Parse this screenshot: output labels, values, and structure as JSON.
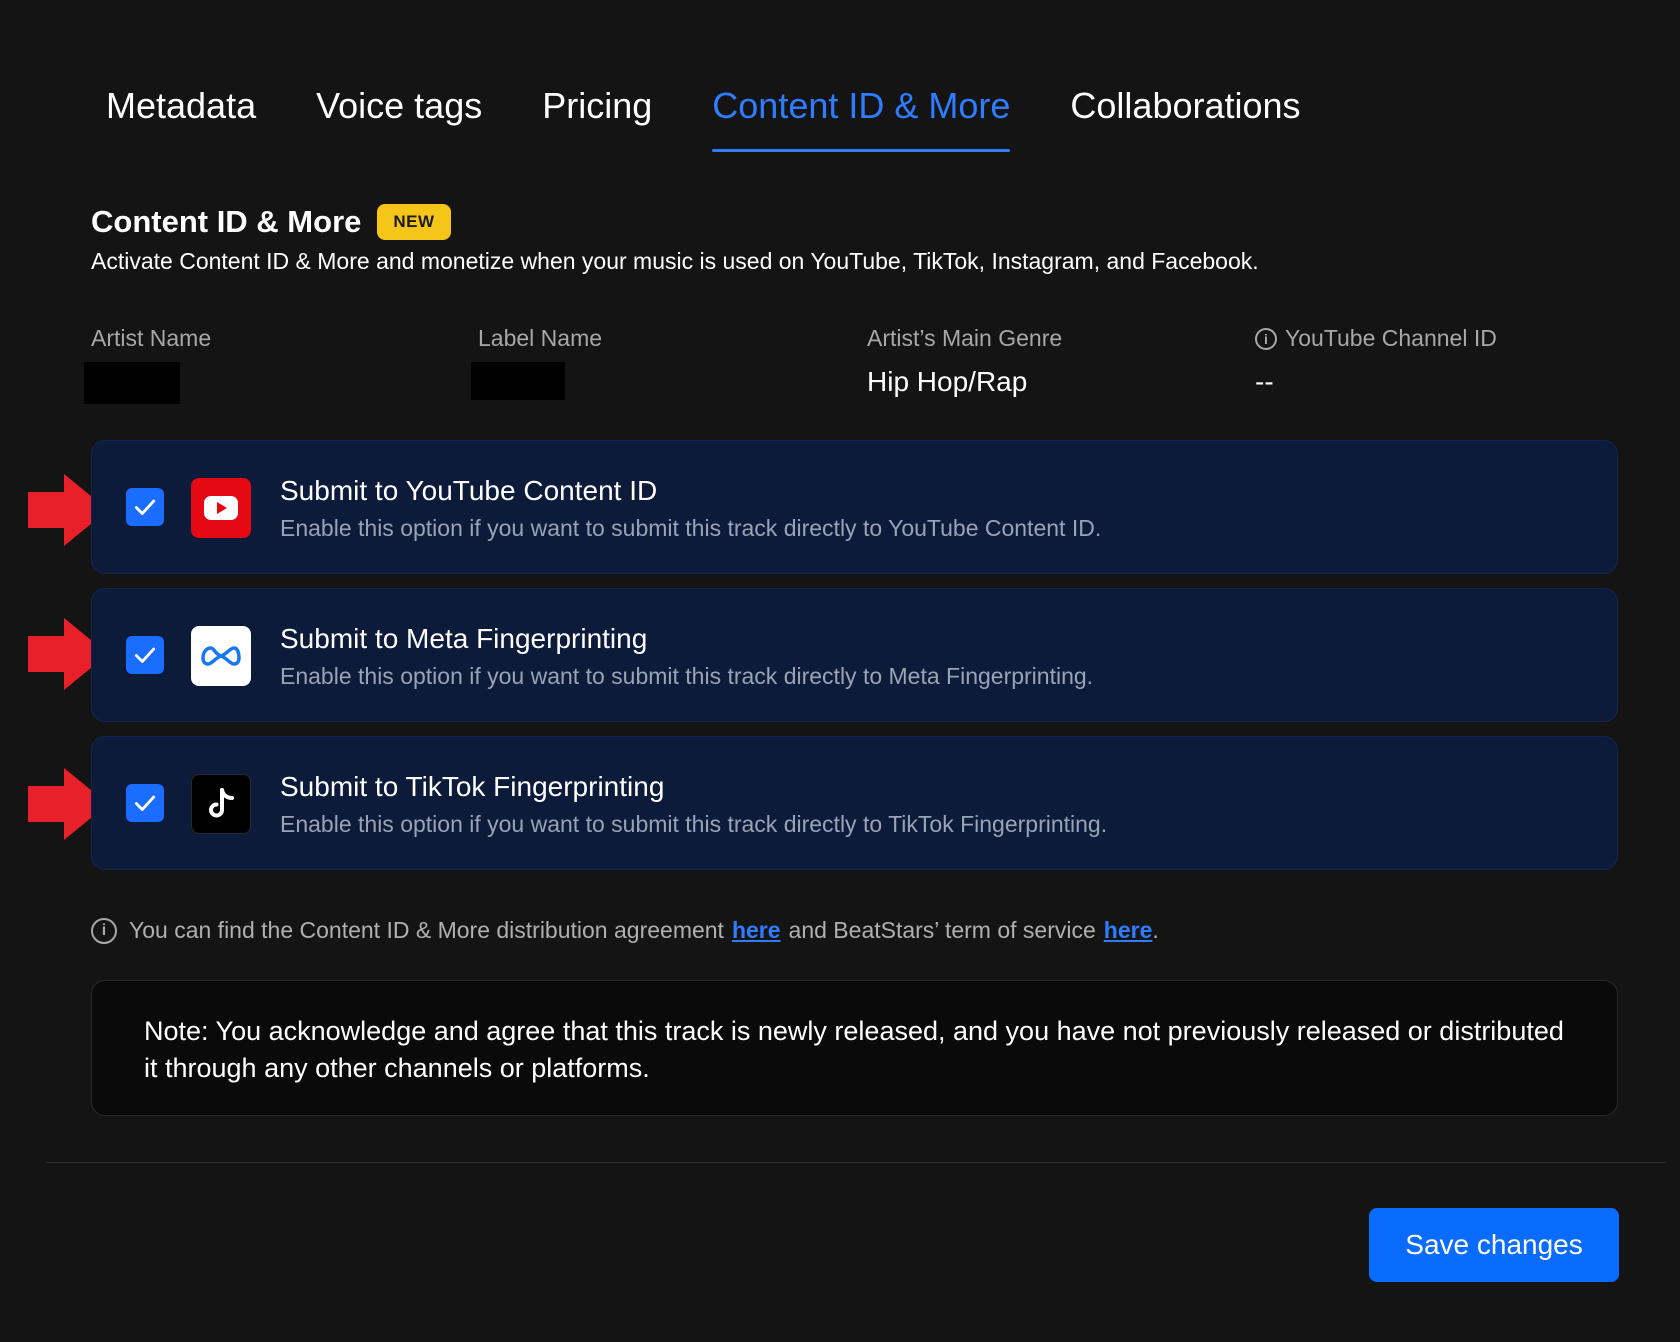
{
  "tabs": [
    {
      "label": "Metadata",
      "active": false
    },
    {
      "label": "Voice tags",
      "active": false
    },
    {
      "label": "Pricing",
      "active": false
    },
    {
      "label": "Content ID & More",
      "active": true
    },
    {
      "label": "Collaborations",
      "active": false
    }
  ],
  "section": {
    "title": "Content ID & More",
    "badge": "NEW",
    "description": "Activate Content ID & More and monetize when your music is used on YouTube, TikTok, Instagram, and Facebook."
  },
  "info": {
    "artist_name_label": "Artist Name",
    "label_name_label": "Label Name",
    "genre_label": "Artist’s Main Genre",
    "genre_value": "Hip Hop/Rap",
    "channel_label": "YouTube Channel ID",
    "channel_value": "--"
  },
  "options": [
    {
      "title": "Submit to YouTube Content ID",
      "desc": "Enable this option if you want to submit this track directly to YouTube Content ID.",
      "checked": true,
      "icon": "youtube-icon"
    },
    {
      "title": "Submit to Meta Fingerprinting",
      "desc": "Enable this option if you want to submit this track directly to Meta Fingerprinting.",
      "checked": true,
      "icon": "meta-icon"
    },
    {
      "title": "Submit to TikTok Fingerprinting",
      "desc": "Enable this option if you want to submit this track directly to TikTok Fingerprinting.",
      "checked": true,
      "icon": "tiktok-icon"
    }
  ],
  "agreement": {
    "text_1": "You can find the Content ID & More distribution agreement",
    "link_1": "here",
    "text_2": "and BeatStars’ term of service",
    "link_2": "here",
    "text_3": "."
  },
  "note": "Note: You acknowledge and agree that this track is newly released, and you have not previously released or distributed it through any other channels or platforms.",
  "save_label": "Save changes",
  "colors": {
    "background": "#141414",
    "accent": "#2f7cff",
    "card": "#0d1b3a",
    "badge": "#f5c518",
    "arrow": "#e8202a",
    "button": "#0a6cff"
  }
}
